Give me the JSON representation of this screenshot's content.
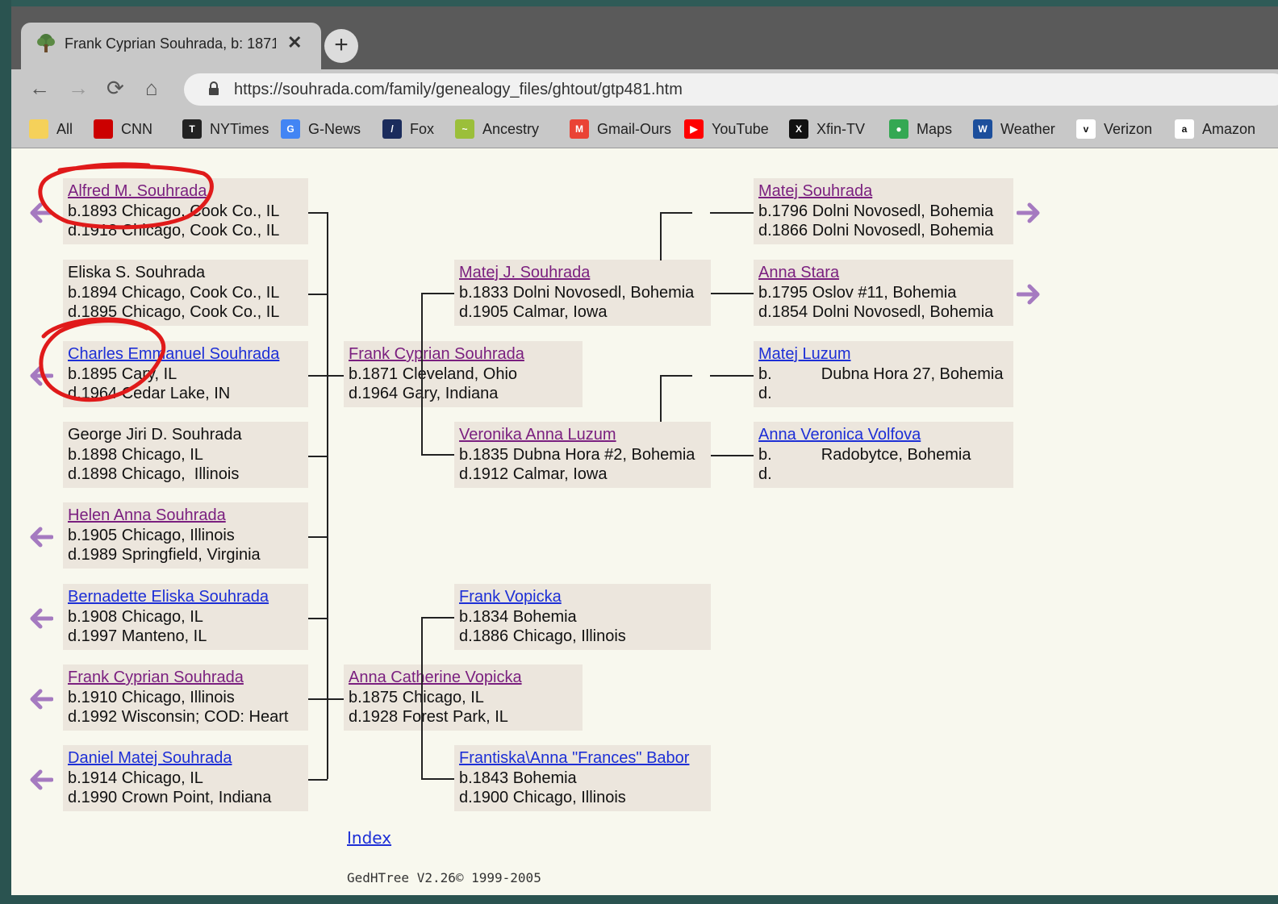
{
  "tab": {
    "title": "Frank Cyprian Souhrada, b: 1871",
    "close": "✕",
    "new_tab": "+"
  },
  "toolbar": {
    "back": "←",
    "forward": "→",
    "reload": "⟳",
    "home": "⌂",
    "url": "https://souhrada.com/family/genealogy_files/ghtout/gtp481.htm"
  },
  "bookmarks": [
    {
      "label": "All",
      "icon": "folder-icon",
      "color": "#f5d15a"
    },
    {
      "label": "CNN",
      "icon": "cnn-icon",
      "color": "#cc0000",
      "icon_text": "CNN"
    },
    {
      "label": "NYTimes",
      "icon": "nytimes-icon",
      "color": "#222222",
      "icon_text": "T"
    },
    {
      "label": "G-News",
      "icon": "gnews-icon",
      "color": "#4285f4",
      "icon_text": "G"
    },
    {
      "label": "Fox",
      "icon": "fox-icon",
      "color": "#1b2c5c",
      "icon_text": "/"
    },
    {
      "label": "Ancestry",
      "icon": "ancestry-icon",
      "color": "#9bbf3a",
      "icon_text": "~"
    },
    {
      "label": "Gmail-Ours",
      "icon": "gmail-icon",
      "color": "#ea4335",
      "icon_text": "M"
    },
    {
      "label": "YouTube",
      "icon": "youtube-icon",
      "color": "#ff0000",
      "icon_text": "▶"
    },
    {
      "label": "Xfin-TV",
      "icon": "xfinity-icon",
      "color": "#111111",
      "icon_text": "X"
    },
    {
      "label": "Maps",
      "icon": "maps-icon",
      "color": "#34a853",
      "icon_text": "●"
    },
    {
      "label": "Weather",
      "icon": "weather-icon",
      "color": "#1c4f9c",
      "icon_text": "W"
    },
    {
      "label": "Verizon",
      "icon": "verizon-icon",
      "color": "#ffffff",
      "icon_text": "v"
    },
    {
      "label": "Amazon",
      "icon": "amazon-icon",
      "color": "#ffffff",
      "icon_text": "a"
    }
  ],
  "children": [
    {
      "name": "Alfred M. Souhrada",
      "link": "visited",
      "lines": [
        "b.1893 Chicago, Cook Co., IL",
        "d.1918 Chicago, Cook Co., IL"
      ],
      "has_arrow": true
    },
    {
      "name": "Eliska S. Souhrada",
      "link": "none",
      "lines": [
        "b.1894 Chicago, Cook Co., IL",
        "d.1895 Chicago, Cook Co., IL"
      ],
      "has_arrow": false
    },
    {
      "name": "Charles Emmanuel Souhrada",
      "link": "unvisited",
      "lines": [
        "b.1895 Cary, IL",
        "d.1964 Cedar Lake, IN"
      ],
      "has_arrow": true
    },
    {
      "name": "George Jiri D. Souhrada",
      "link": "none",
      "lines": [
        "b.1898 Chicago, IL",
        "d.1898 Chicago,  Illinois"
      ],
      "has_arrow": false
    },
    {
      "name": "Helen Anna Souhrada",
      "link": "visited",
      "lines": [
        "b.1905 Chicago, Illinois",
        "d.1989 Springfield, Virginia"
      ],
      "has_arrow": true
    },
    {
      "name": "Bernadette Eliska Souhrada",
      "link": "unvisited",
      "lines": [
        "b.1908 Chicago, IL",
        "d.1997 Manteno, IL"
      ],
      "has_arrow": true
    },
    {
      "name": "Frank Cyprian Souhrada",
      "link": "visited",
      "lines": [
        "b.1910 Chicago, Illinois",
        "d.1992 Wisconsin; COD: Heart"
      ],
      "has_arrow": true
    },
    {
      "name": "Daniel Matej Souhrada",
      "link": "unvisited",
      "lines": [
        "b.1914 Chicago, IL",
        "d.1990 Crown Point, Indiana"
      ],
      "has_arrow": true
    }
  ],
  "parents": [
    {
      "name": "Frank Cyprian Souhrada",
      "link": "visited",
      "lines": [
        "b.1871 Cleveland, Ohio",
        "d.1964 Gary, Indiana"
      ]
    },
    {
      "name": "Anna Catherine Vopicka",
      "link": "visited",
      "lines": [
        "b.1875 Chicago, IL",
        "d.1928 Forest Park, IL"
      ]
    }
  ],
  "grandparents": [
    {
      "name": "Matej J. Souhrada",
      "link": "visited",
      "lines": [
        "b.1833 Dolni Novosedl, Bohemia",
        "d.1905 Calmar, Iowa"
      ]
    },
    {
      "name": "Veronika Anna Luzum",
      "link": "visited",
      "lines": [
        "b.1835 Dubna Hora #2, Bohemia",
        "d.1912 Calmar, Iowa"
      ]
    },
    {
      "name": "Frank Vopicka",
      "link": "unvisited",
      "lines": [
        "b.1834 Bohemia",
        "d.1886 Chicago, Illinois"
      ]
    },
    {
      "name": "Frantiska\\Anna \"Frances\" Babor",
      "link": "unvisited",
      "lines": [
        "b.1843 Bohemia",
        "d.1900 Chicago, Illinois"
      ]
    }
  ],
  "great_grandparents": [
    {
      "name": "Matej Souhrada",
      "link": "visited",
      "lines": [
        "b.1796 Dolni Novosedl, Bohemia",
        "d.1866 Dolni Novosedl, Bohemia"
      ],
      "has_arrow": true
    },
    {
      "name": "Anna Stara",
      "link": "visited",
      "lines": [
        "b.1795 Oslov #11, Bohemia",
        "d.1854 Dolni Novosedl, Bohemia"
      ],
      "has_arrow": true
    },
    {
      "name": "Matej Luzum",
      "link": "unvisited",
      "lines": [
        "b.           Dubna Hora 27, Bohemia",
        "d."
      ],
      "has_arrow": false
    },
    {
      "name": "Anna Veronica Volfova",
      "link": "unvisited",
      "lines": [
        "b.           Radobytce, Bohemia",
        "d."
      ],
      "has_arrow": false
    }
  ],
  "index_label": "Index",
  "footer": "GedHTree V2.26© 1999-2005",
  "colors": {
    "visited_link": "#7a1f7f",
    "link": "#1d2fd6",
    "box_bg": "#ece6dd",
    "arrow": "#a57ac0",
    "annotation": "#e01a1a"
  }
}
